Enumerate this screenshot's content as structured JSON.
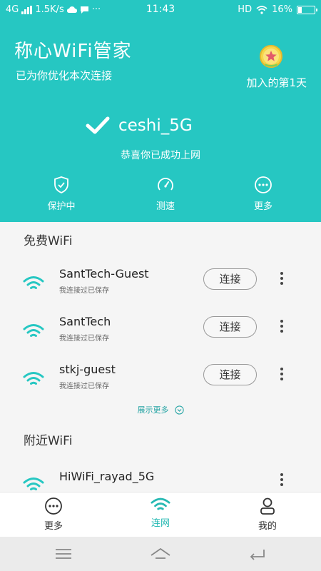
{
  "status_bar": {
    "network": "4G",
    "speed": "1.5K/s",
    "time": "11:43",
    "hd": "HD",
    "battery": "16%"
  },
  "header": {
    "title": "称心WiFi管家",
    "subtitle": "已为你优化本次连接",
    "joined": "加入的第1天",
    "connected_ssid": "ceshi_5G",
    "connected_msg": "恭喜你已成功上网",
    "quick_actions": [
      {
        "label": "保护中",
        "icon": "shield-check-icon"
      },
      {
        "label": "测速",
        "icon": "speedometer-icon"
      },
      {
        "label": "更多",
        "icon": "more-circle-icon"
      }
    ]
  },
  "free_wifi": {
    "title": "免费WiFi",
    "items": [
      {
        "name": "SantTech-Guest",
        "sub": "我连接过已保存",
        "button": "连接"
      },
      {
        "name": "SantTech",
        "sub": "我连接过已保存",
        "button": "连接"
      },
      {
        "name": "stkj-guest",
        "sub": "我连接过已保存",
        "button": "连接"
      }
    ],
    "show_more": "展示更多"
  },
  "nearby_wifi": {
    "title": "附近WiFi",
    "items": [
      {
        "name": "HiWiFi_rayad_5G"
      }
    ]
  },
  "tabs": [
    {
      "label": "更多",
      "icon": "more-circle-icon",
      "active": false
    },
    {
      "label": "连网",
      "icon": "wifi-icon",
      "active": true
    },
    {
      "label": "我的",
      "icon": "user-icon",
      "active": false
    }
  ],
  "colors": {
    "accent": "#26c7c2",
    "active_tab": "#26b9b3"
  }
}
